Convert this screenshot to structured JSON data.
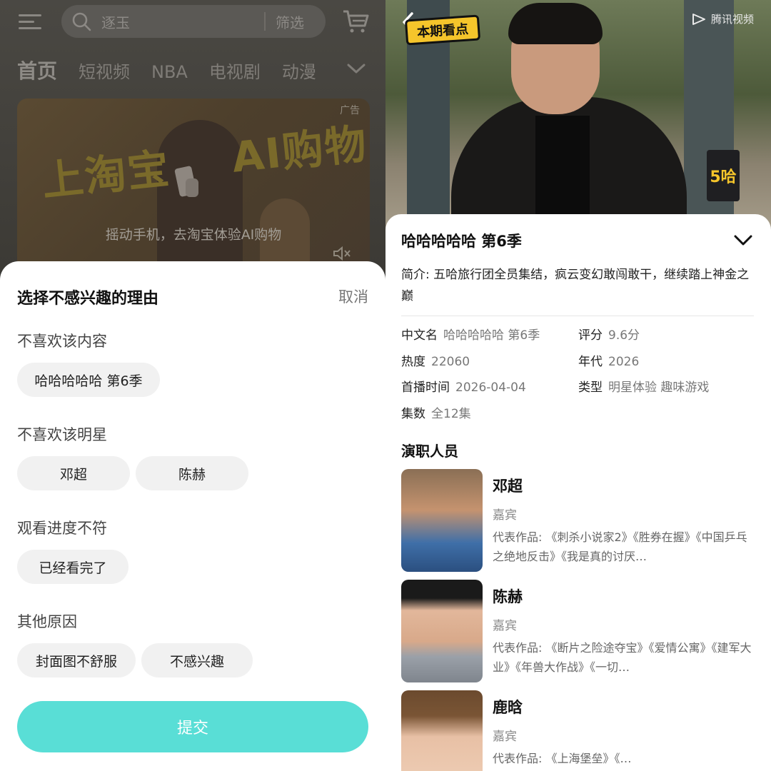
{
  "left": {
    "search": {
      "placeholder": "逐玉",
      "filter_label": "筛选"
    },
    "nav_tabs": [
      "首页",
      "短视频",
      "NBA",
      "电视剧",
      "动漫"
    ],
    "ad": {
      "tag": "广告",
      "headline_left": "上淘宝",
      "headline_right": "AI购物",
      "caption": "摇动手机，去淘宝体验AI购物"
    },
    "sheet": {
      "title": "选择不感兴趣的理由",
      "cancel": "取消",
      "sections": [
        {
          "title": "不喜欢该内容",
          "options": [
            "哈哈哈哈哈 第6季"
          ]
        },
        {
          "title": "不喜欢该明星",
          "options": [
            "邓超",
            "陈赫"
          ]
        },
        {
          "title": "观看进度不符",
          "options": [
            "已经看完了"
          ]
        },
        {
          "title": "其他原因",
          "options": [
            "封面图不舒服",
            "不感兴趣"
          ]
        }
      ],
      "submit": "提交"
    }
  },
  "right": {
    "video": {
      "badge": "本期看点",
      "platform": "腾讯视频",
      "show_logo": "5哈"
    },
    "show": {
      "title": "哈哈哈哈哈 第6季",
      "synopsis": "简介: 五哈旅行团全员集结，疯云变幻敢闯敢干，继续踏上神金之巅",
      "meta": {
        "name_label": "中文名",
        "name_value": "哈哈哈哈哈 第6季",
        "rating_label": "评分",
        "rating_value": "9.6分",
        "heat_label": "热度",
        "heat_value": "22060",
        "year_label": "年代",
        "year_value": "2026",
        "premiere_label": "首播时间",
        "premiere_value": "2026-04-04",
        "genre_label": "类型",
        "genre_value": "明星体验 趣味游戏",
        "episodes_label": "集数",
        "episodes_value": "全12集"
      }
    },
    "cast_title": "演职人员",
    "cast": [
      {
        "name": "邓超",
        "role": "嘉宾",
        "works": "代表作品: 《刺杀小说家2》《胜券在握》《中国乒乓之绝地反击》《我是真的讨厌…"
      },
      {
        "name": "陈赫",
        "role": "嘉宾",
        "works": "代表作品: 《断片之险途夺宝》《爱情公寓》《建军大业》《年兽大作战》《一切…"
      },
      {
        "name": "鹿晗",
        "role": "嘉宾",
        "works": "代表作品: 《上海堡垒》《…"
      }
    ]
  },
  "colors": {
    "submit_bg": "#59ded6",
    "badge_yellow": "#f5c52b"
  }
}
